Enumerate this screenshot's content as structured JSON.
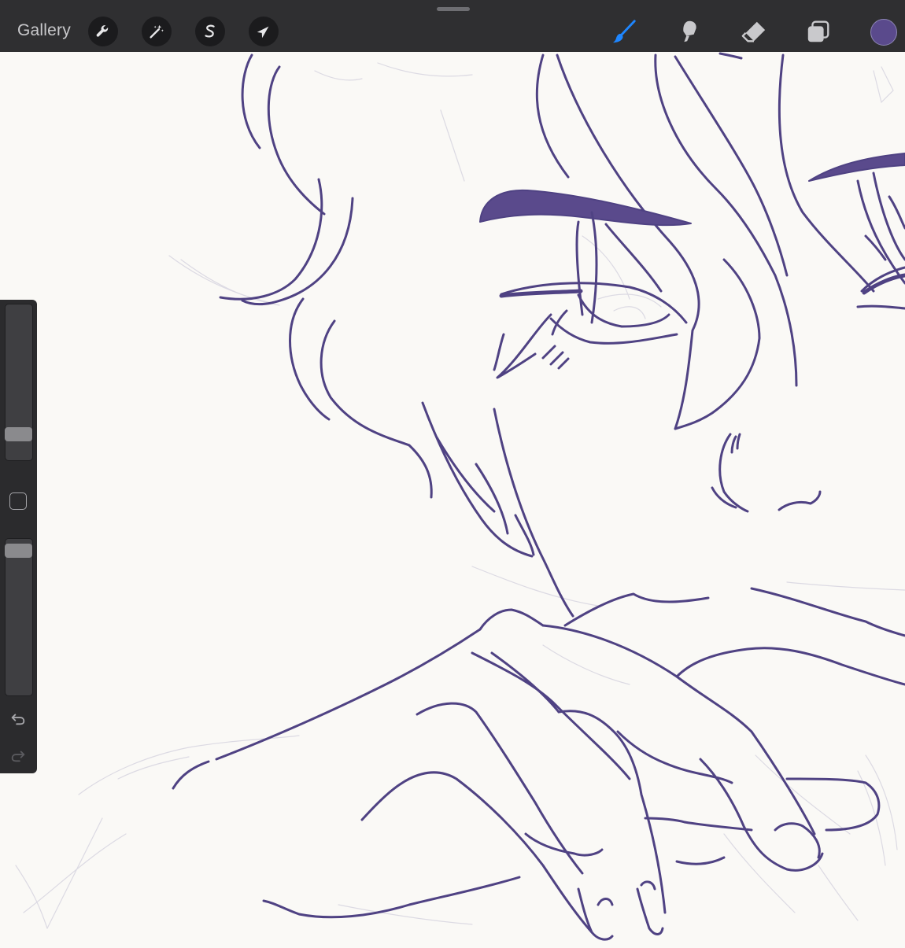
{
  "app": {
    "gallery_label": "Gallery",
    "left_tools": [
      "wrench-icon",
      "magic-wand-icon",
      "selection-s-icon",
      "arrow-icon"
    ],
    "right_tools": [
      "brush-icon",
      "smudge-icon",
      "eraser-icon",
      "layers-icon"
    ],
    "active_tool": "brush-icon"
  },
  "colors": {
    "toolbar_bg": "#2f2f31",
    "accent_blue": "#1e86ff",
    "current_color": "#5a4a8c",
    "line_color": "#4f4283",
    "canvas_bg": "#faf9f6",
    "sketch_color": "#d8d6e0"
  },
  "sidebar": {
    "brush_size_level": 0.87,
    "opacity_level": 0.04,
    "modify_button": "square-icon",
    "undo": "undo-icon",
    "redo": "redo-icon",
    "redo_enabled": false
  }
}
